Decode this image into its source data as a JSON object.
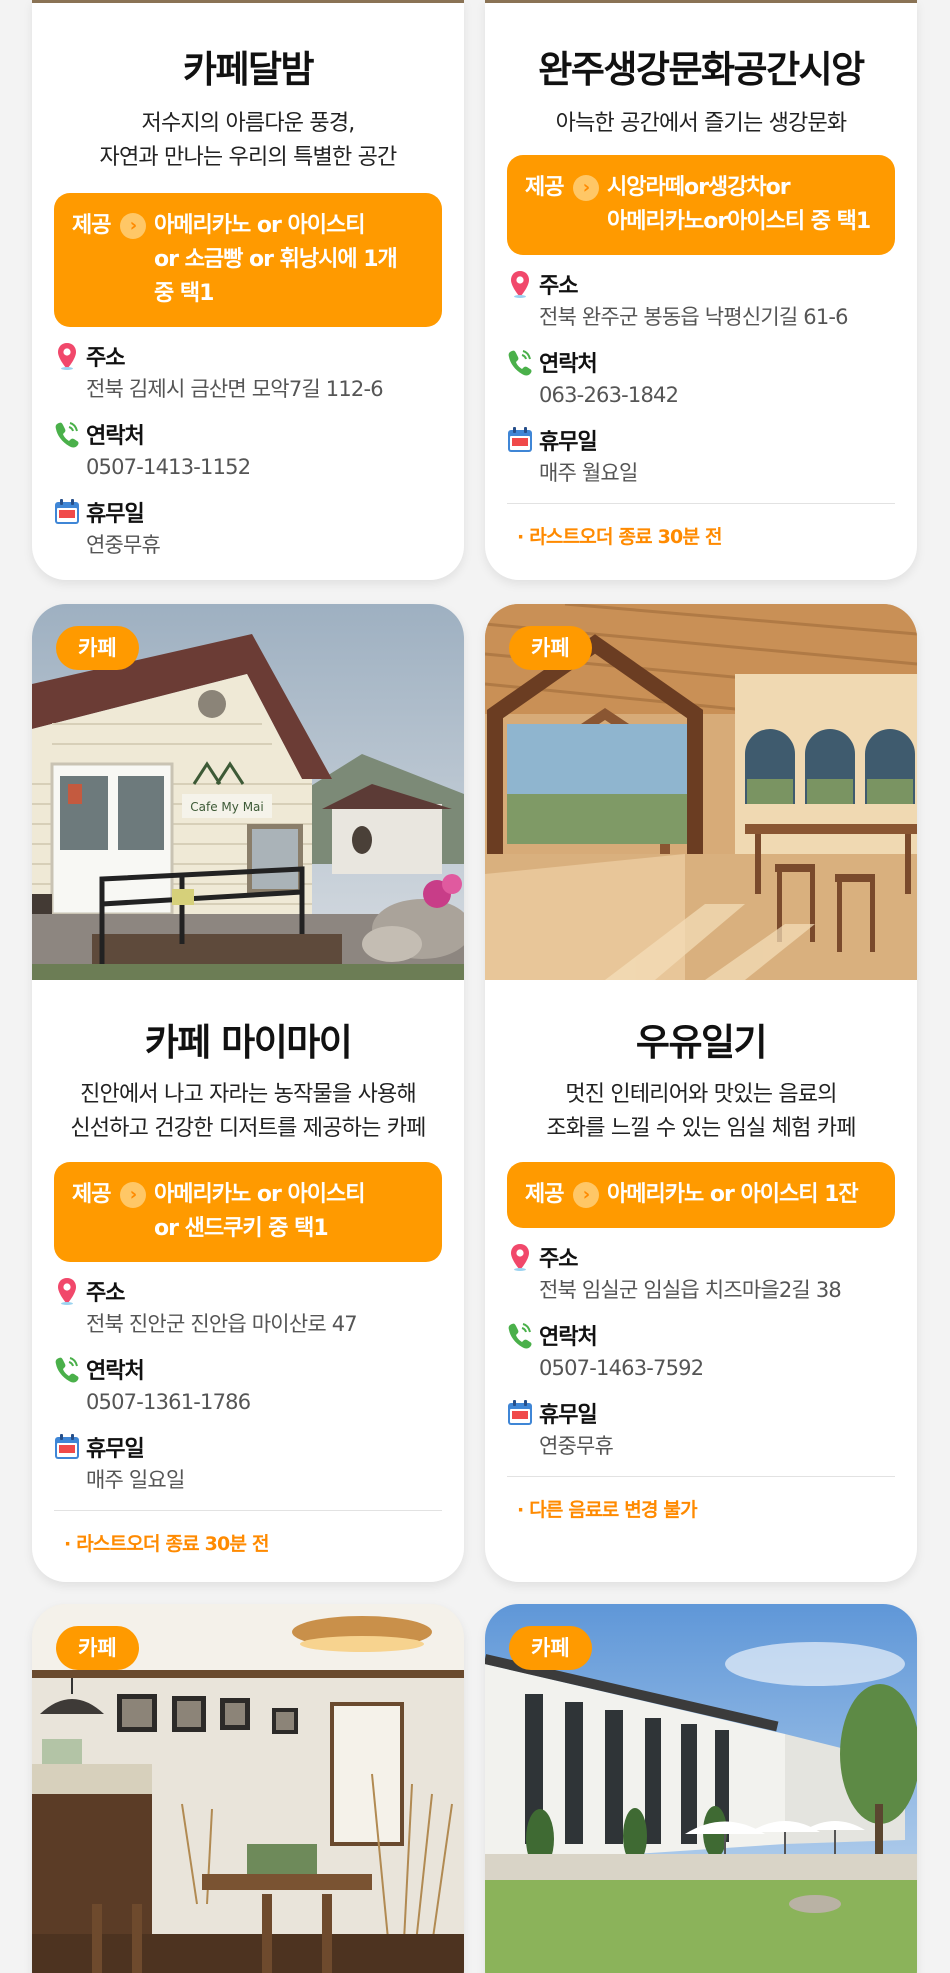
{
  "colors": {
    "accent": "#ff9a00",
    "card_bg": "#ffffff",
    "page_bg": "#f3f3f3"
  },
  "cards": [
    {
      "title": "카페달밤",
      "desc": [
        "저수지의 아름다운 풍경,",
        "자연과 만나는 우리의 특별한 공간"
      ],
      "offer_label": "제공",
      "offer_text": "아메리카노 or 아이스티\nor 소금빵 or 휘낭시에 1개\n중 택1",
      "address_label": "주소",
      "address": "전북 김제시 금산면 모악7길 112-6",
      "contact_label": "연락처",
      "contact": "0507-1413-1152",
      "closed_label": "휴무일",
      "closed": "연중무휴"
    },
    {
      "title": "완주생강문화공간시앙",
      "desc": [
        "아늑한 공간에서 즐기는 생강문화"
      ],
      "offer_label": "제공",
      "offer_text": "시앙라떼or생강차or\n아메리카노or아이스티 중 택1",
      "address_label": "주소",
      "address": "전북 완주군 봉동읍 낙평신기길 61-6",
      "contact_label": "연락처",
      "contact": "063-263-1842",
      "closed_label": "휴무일",
      "closed": "매주 월요일",
      "note": "· 라스트오더 종료 30분 전"
    },
    {
      "tag": "카페",
      "image": "cafe-mymai-exterior-photo",
      "title": "카페 마이마이",
      "desc": [
        "진안에서 나고 자라는 농작물을 사용해",
        "신선하고 건강한 디저트를 제공하는 카페"
      ],
      "offer_label": "제공",
      "offer_text": "아메리카노 or 아이스티\nor 샌드쿠키 중 택1",
      "address_label": "주소",
      "address": "전북 진안군 진안읍 마이산로 47",
      "contact_label": "연락처",
      "contact": "0507-1361-1786",
      "closed_label": "휴무일",
      "closed": "매주 일요일",
      "note": "· 라스트오더 종료 30분 전"
    },
    {
      "tag": "카페",
      "image": "wooden-cafe-interior-photo",
      "title": "우유일기",
      "desc": [
        "멋진 인테리어와 맛있는 음료의",
        "조화를 느낄 수 있는 임실 체험 카페"
      ],
      "offer_label": "제공",
      "offer_text": "아메리카노 or 아이스티 1잔",
      "address_label": "주소",
      "address": "전북 임실군 임실읍 치즈마을2길 38",
      "contact_label": "연락처",
      "contact": "0507-1463-7592",
      "closed_label": "휴무일",
      "closed": "연중무휴",
      "note": "· 다른 음료로 변경 불가"
    },
    {
      "tag": "카페",
      "image": "rustic-cafe-interior-photo"
    },
    {
      "tag": "카페",
      "image": "white-building-cafe-photo"
    }
  ]
}
